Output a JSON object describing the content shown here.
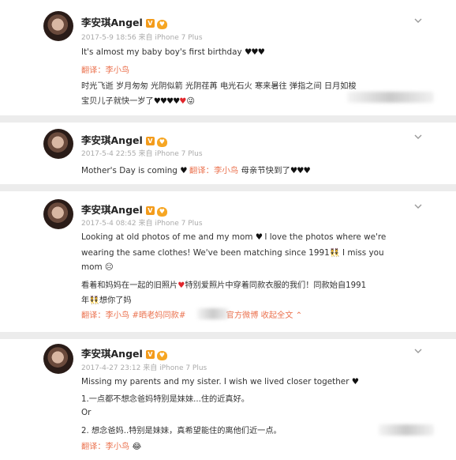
{
  "posts": [
    {
      "username": "李安琪Angel",
      "meta": "2017-5-9 18:56 来自 iPhone 7 Plus",
      "lines": [
        "It's almost my baby boy's first birthday",
        "翻译：李小鸟",
        "时光飞逝 岁月匆匆 光阴似箭 光阴荏苒 电光石火 寒来暑往 弹指之间 日月如梭",
        "宝贝儿子就快一岁了"
      ]
    },
    {
      "username": "李安琪Angel",
      "meta": "2017-5-4 22:55 来自 iPhone 7 Plus",
      "lines": [
        "Mother's Day is coming",
        "翻译：李小鸟",
        "母亲节快到了"
      ]
    },
    {
      "username": "李安琪Angel",
      "meta": "2017-5-4 08:42 来自 iPhone 7 Plus",
      "lines": [
        "Looking at old photos of me and my mom",
        "I love the photos where we're",
        "wearing the same clothes! We've been matching since 1991",
        "I miss you",
        "mom",
        "看着和妈妈在一起的旧照片",
        "特别爱照片中穿着同款衣服的我们！同款始自1991",
        "年",
        "想你了妈",
        "翻译：李小鸟",
        "#晒老妈同款#",
        "官方微博",
        "收起全文"
      ]
    },
    {
      "username": "李安琪Angel",
      "meta": "2017-4-27 23:12 来自 iPhone 7 Plus",
      "lines": [
        "Missing my parents and my sister. I wish we lived closer together",
        "1.一点都不想念爸妈特别是妹妹...住的近真好。",
        "Or",
        "2. 想念爸妈..特别是妹妹，真希望能住的离他们近一点。",
        "翻译：李小鸟"
      ]
    }
  ],
  "icons": {
    "verified": "V",
    "level": "vip-badge-icon"
  },
  "colors": {
    "accent": "#eb7350",
    "meta": "#aaaaaa",
    "separator": "#ececec"
  }
}
